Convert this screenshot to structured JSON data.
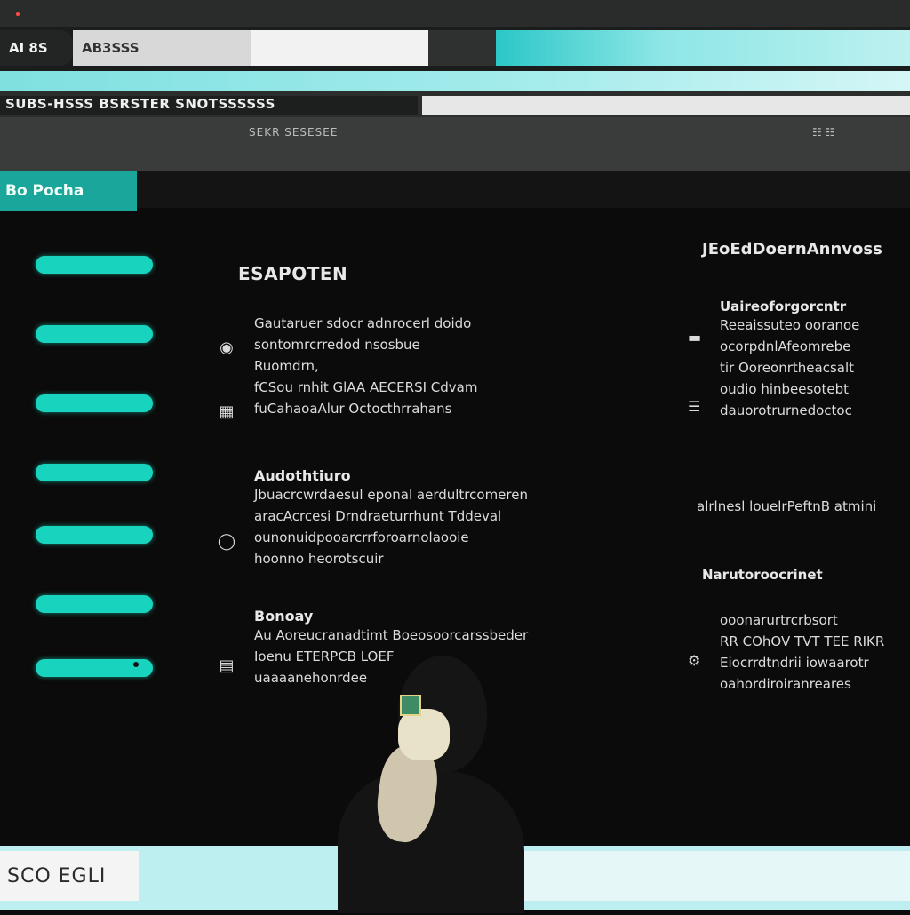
{
  "browser": {
    "tabs": [
      {
        "label": "AI 8S"
      },
      {
        "label": "AB3SSS"
      },
      {
        "label": ""
      },
      {
        "label": ""
      }
    ],
    "address": "SUBS-HSSS BSRSTER SNOTSSSSSS",
    "toolbar_crumbs": "SEKR SESESEE"
  },
  "header": {
    "pill_label": "Bo Pocha"
  },
  "sidebar": {
    "items": [
      {
        "label": ""
      },
      {
        "label": ""
      },
      {
        "label": ""
      },
      {
        "label": ""
      },
      {
        "label": ""
      },
      {
        "label": ""
      },
      {
        "label": ""
      }
    ]
  },
  "main": {
    "heading": "ESAPOTEN",
    "blocks": [
      {
        "icon": "circle-icon",
        "title": "",
        "lines": [
          "Gautaruer sdocr adnrocerl doido",
          "sontomrcrredod nsosbue",
          "Ruomdrn,",
          "fCSou rnhit GlAA AECERSI Cdvam",
          "fuCahaoaAlur Octocthrrahans"
        ]
      },
      {
        "icon": "circle-icon",
        "title": "Audothtiuro",
        "lines": [
          "Jbuacrcwrdaesul eponal aerdultrcomeren",
          "aracAcrcesi Drndraeturrhunt Tddeval",
          "ounonuidpooarcrrforoarnolaooie",
          "hoonno heorotscuir"
        ]
      },
      {
        "icon": "stack-icon",
        "title": "Bonoay",
        "lines": [
          "Au Aoreucranadtimt Boeosoorcarssbeder",
          "Ioenu ETERPCB LOEF",
          "uaaaanehonrdee"
        ]
      }
    ]
  },
  "right_panel": {
    "head": "JEoEdDoernAnnvoss",
    "blocks": [
      {
        "icon": "dash-icon",
        "title": "Uaireoforgorcntr",
        "lines": [
          "Reeaissuteo ooranoe",
          "ocorpdnlAfeomrebe",
          "tir Ooreonrtheacsalt",
          "oudio hinbeesotebt",
          "dauorotrurnedoctoc"
        ]
      },
      {
        "icon": "",
        "title": "",
        "lines": [
          "alrlnesl louelrPeftnB atmini"
        ]
      },
      {
        "icon": "",
        "title": "Narutoroocrinet",
        "lines": []
      },
      {
        "icon": "gear-icon",
        "title": "",
        "lines": [
          "ooonarurtrcrbsort",
          "RR COhOV TVT TEE RIKR",
          "Eiocrrdtndrii iowaarotr",
          "oahordiroiranreares"
        ]
      }
    ]
  },
  "footer": {
    "left_label": "SCO EGLI"
  },
  "colors": {
    "teal": "#18d3bd",
    "pill": "#1aa69a",
    "cyan_glow": "#8ee6e6",
    "background": "#0b0b0b"
  }
}
